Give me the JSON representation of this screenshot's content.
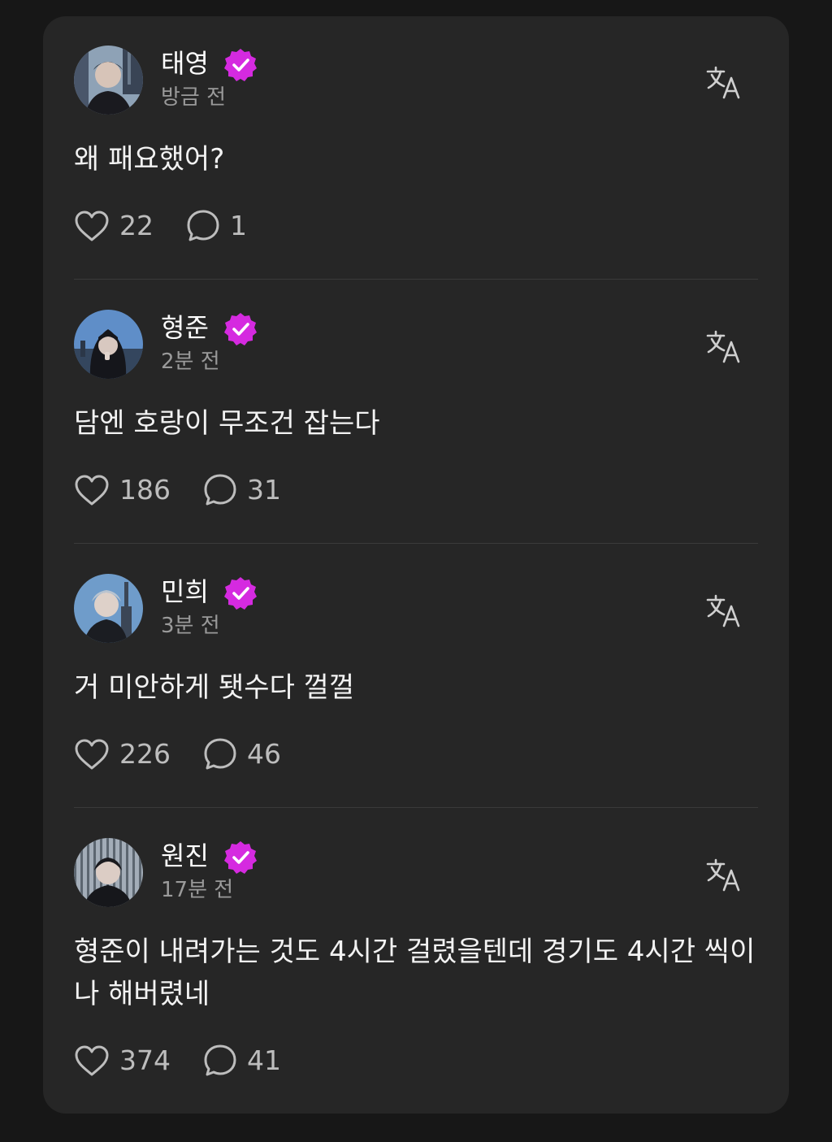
{
  "posts": [
    {
      "author": "태영",
      "time": "방금 전",
      "text": "왜 패요했어?",
      "likes": "22",
      "comments": "1",
      "avatar_icon": "person-avatar-city",
      "avatar_colors": [
        "#7f93a8",
        "#2b2f37"
      ]
    },
    {
      "author": "형준",
      "time": "2분 전",
      "text": "담엔 호랑이 무조건 잡는다",
      "likes": "186",
      "comments": "31",
      "avatar_icon": "person-avatar-hood",
      "avatar_colors": [
        "#5a86c0",
        "#1f2430"
      ]
    },
    {
      "author": "민희",
      "time": "3분 전",
      "text": "거 미안하게 됏수다 껄껄",
      "likes": "226",
      "comments": "46",
      "avatar_icon": "person-avatar-sky",
      "avatar_colors": [
        "#6b98c6",
        "#2d3440"
      ]
    },
    {
      "author": "원진",
      "time": "17분 전",
      "text": "형준이 내려가는 것도 4시간 걸렸을텐데 경기도 4시간 씩이나 해버렸네",
      "likes": "374",
      "comments": "41",
      "avatar_icon": "person-avatar-building",
      "avatar_colors": [
        "#9aa6b2",
        "#22262c"
      ]
    }
  ],
  "colors": {
    "background": "#171717",
    "card": "#262626",
    "verified_badge": "#d52ae0",
    "text_primary": "#ffffff",
    "text_secondary": "#9a9a9a",
    "icon": "#bdbdbd"
  },
  "icons": {
    "verified": "verified-badge-icon",
    "translate": "translate-icon",
    "like": "heart-icon",
    "comment": "comment-bubble-icon"
  }
}
